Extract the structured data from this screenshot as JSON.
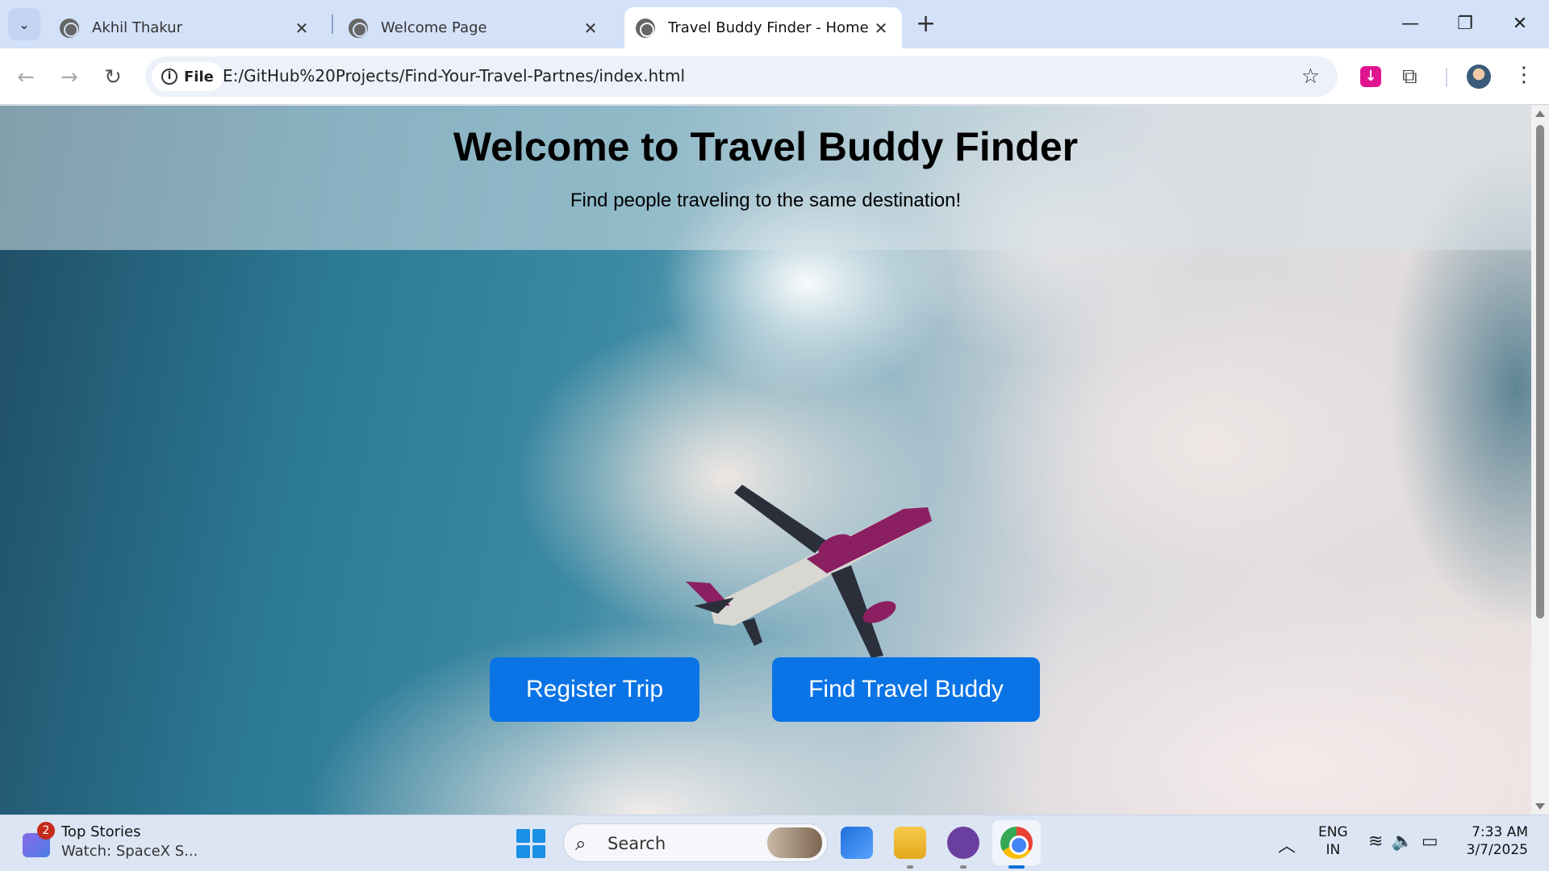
{
  "browser": {
    "tabs": [
      {
        "title": "Akhil Thakur"
      },
      {
        "title": "Welcome Page"
      },
      {
        "title": "Travel Buddy Finder - Home"
      }
    ],
    "file_chip": "File",
    "url": "E:/GitHub%20Projects/Find-Your-Travel-Partnes/index.html"
  },
  "page": {
    "title": "Welcome to Travel Buddy Finder",
    "subtitle": "Find people traveling to the same destination!",
    "buttons": {
      "register": "Register Trip",
      "find": "Find Travel Buddy"
    },
    "accent_color": "#0a74e6"
  },
  "taskbar": {
    "news_badge": "2",
    "news_title": "Top Stories",
    "news_sub": "Watch: SpaceX S...",
    "search_placeholder": "Search",
    "lang_line1": "ENG",
    "lang_line2": "IN",
    "time": "7:33 AM",
    "date": "3/7/2025"
  }
}
